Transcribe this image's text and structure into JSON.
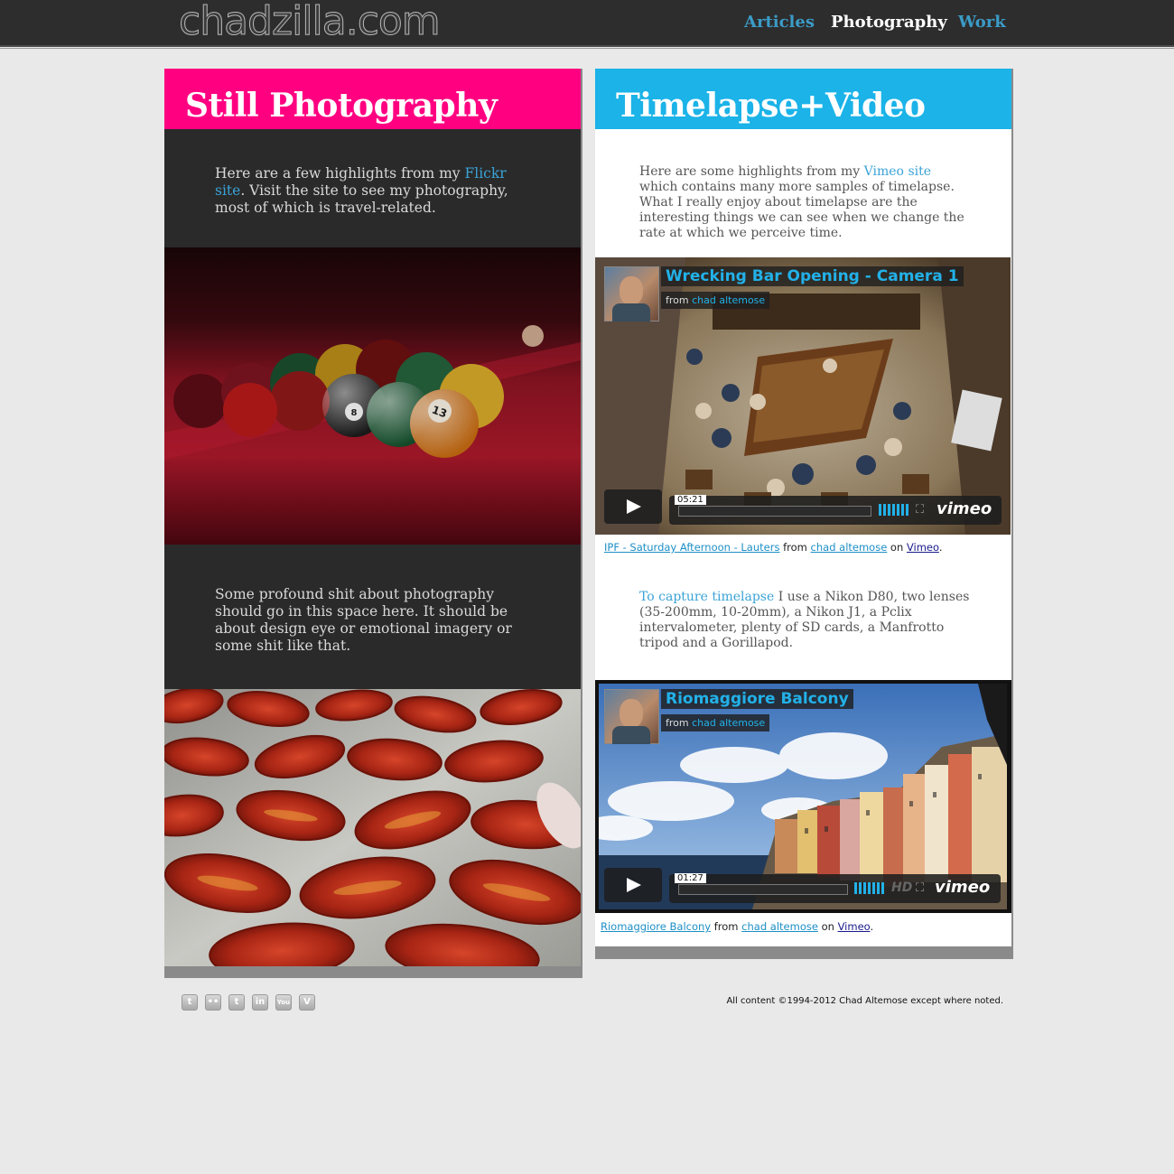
{
  "site": {
    "logo": "chadzilla.com"
  },
  "nav": {
    "articles": "Articles",
    "photography": "Photography",
    "work": "Work"
  },
  "still": {
    "heading": "Still Photography",
    "intro_before": "Here are a few highlights from my ",
    "intro_link": "Flickr site",
    "intro_after": ". Visit the site to see my photography, most of which is travel-related.",
    "body": "Some profound shit about photography should go in this space here. It should be about design eye or emotional imagery or some shit like that.",
    "ball_number_a": "8",
    "ball_number_b": "13"
  },
  "timelapse": {
    "heading": "Timelapse+Video",
    "intro_before": "Here are some highlights from my ",
    "intro_link": "Vimeo site",
    "intro_after": " which contains many more samples of timelapse. What I really enjoy about timelapse are the interesting things we can see when we change the rate at which we perceive time.",
    "gear_link": "To capture timelapse",
    "gear_text": " I use a Nikon D80, two lenses (35-200mm, 10-20mm), a Nikon J1, a Pclix intervalometer, plenty of SD cards, a Manfrotto tripod and a Gorillapod."
  },
  "videos": [
    {
      "title": "Wrecking Bar Opening - Camera 1",
      "from_label": "from",
      "author": "chad altemose",
      "duration": "05:21",
      "brand": "vimeo",
      "caption_link": "IPF - Saturday Afternoon - Lauters",
      "caption_from": " from ",
      "caption_author": "chad altemose",
      "caption_on": " on ",
      "caption_site": "Vimeo",
      "caption_end": "."
    },
    {
      "title": "Riomaggiore Balcony",
      "from_label": "from",
      "author": "chad altemose",
      "duration": "01:27",
      "hd": "HD",
      "brand": "vimeo",
      "caption_link": "Riomaggiore Balcony",
      "caption_from": " from ",
      "caption_author": "chad altemose",
      "caption_on": " on ",
      "caption_site": "Vimeo",
      "caption_end": "."
    }
  ],
  "social": [
    {
      "icon": "twitter-icon",
      "glyph": "t"
    },
    {
      "icon": "flickr-icon",
      "glyph": "••"
    },
    {
      "icon": "tumblr-icon",
      "glyph": "t"
    },
    {
      "icon": "linkedin-icon",
      "glyph": "in"
    },
    {
      "icon": "youtube-icon",
      "glyph": "You"
    },
    {
      "icon": "vimeo-icon",
      "glyph": "V"
    }
  ],
  "footer": {
    "copyright": "All content ©1994-2012 Chad Altemose except where noted."
  },
  "colors": {
    "pink": "#ff0081",
    "blue": "#1bb3e8",
    "dark": "#2a2a2a",
    "link": "#3aa3d6"
  }
}
